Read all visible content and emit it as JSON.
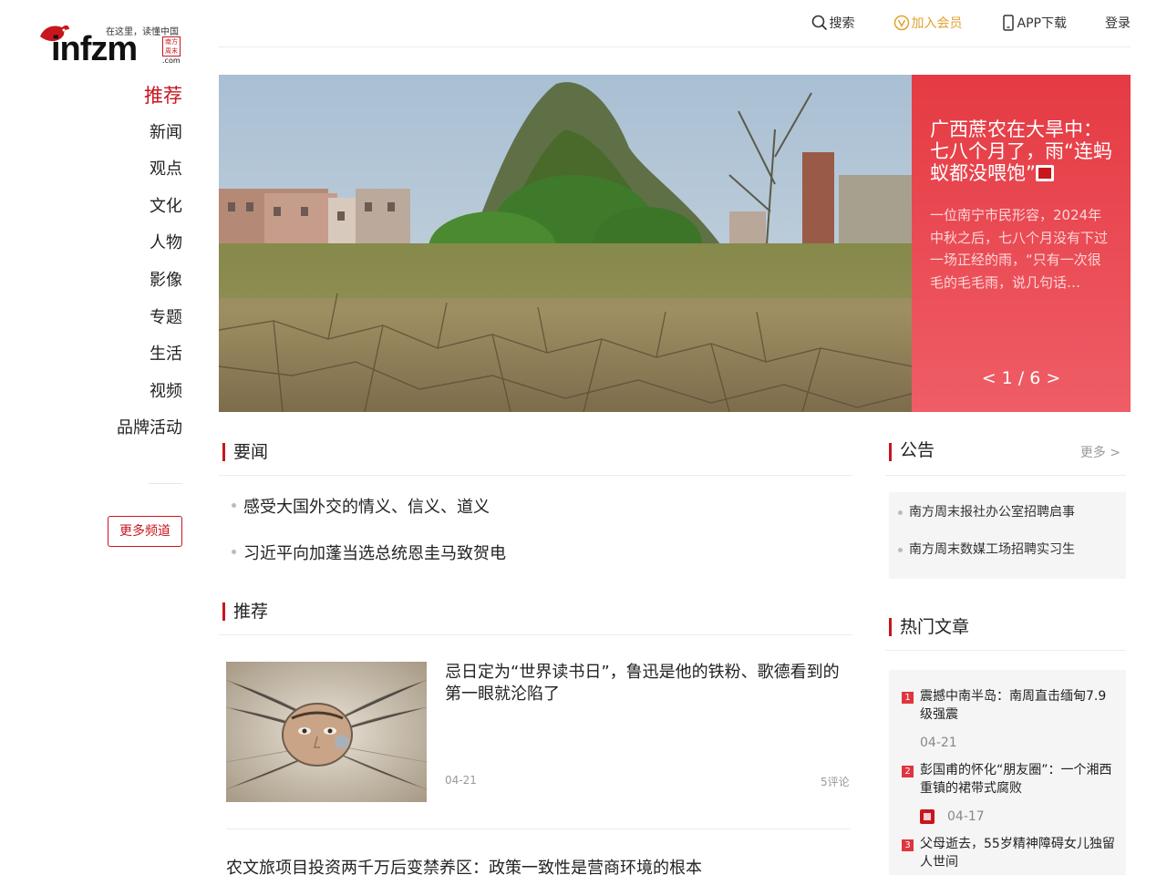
{
  "logo": {
    "wordmark": "infzm",
    "slogan": "在这里，读懂中国",
    "seal": "南方周末",
    "domain_suffix": ".com"
  },
  "topnav": {
    "search": "搜索",
    "vip": "加入会员",
    "app": "APP下载",
    "login": "登录"
  },
  "leftnav": {
    "items": [
      "推荐",
      "新闻",
      "观点",
      "文化",
      "人物",
      "影像",
      "专题",
      "生活",
      "视频",
      "品牌活动"
    ],
    "more_channels": "更多频道"
  },
  "hero": {
    "title": "广西蔗农在大旱中：七八个月了，雨“连蚂蚁都没喂饱”",
    "summary": "一位南宁市民形容，2024年中秋之后，七八个月没有下过一场正经的雨，“只有一次很毛的毛毛雨，说几句话…",
    "pager": "< 1 / 6 >"
  },
  "headlines": {
    "title": "要闻",
    "items": [
      "感受大国外交的情义、信义、道义",
      "习近平向加蓬当选总统恩圭马致贺电"
    ]
  },
  "recommend": {
    "title": "推荐",
    "card": {
      "title": "忌日定为“世界读书日”，鲁迅是他的铁粉、歌德看到的第一眼就沦陷了",
      "date": "04-21",
      "comments": "5评论"
    },
    "next_title": "农文旅项目投资两千万后变禁养区：政策一致性是营商环境的根本"
  },
  "notice": {
    "title": "公告",
    "more": "更多 >",
    "items": [
      "南方周末报社办公室招聘启事",
      "南方周末数媒工场招聘实习生"
    ]
  },
  "hot": {
    "title": "热门文章",
    "items": [
      {
        "num": "1",
        "title": "震撼中南半岛：南周直击缅甸7.9级强震",
        "date": "04-21",
        "has_icon": false
      },
      {
        "num": "2",
        "title": "彭国甫的怀化“朋友圈”：一个湘西重镇的裙带式腐败",
        "date": "04-17",
        "has_icon": true
      },
      {
        "num": "3",
        "title": "父母逝去，55岁精神障碍女儿独留人世间",
        "date": "",
        "has_icon": false
      }
    ]
  },
  "colors": {
    "brand_red": "#c7161e",
    "hero_panel": "#e53a43",
    "vip_gold": "#e0a22f"
  }
}
